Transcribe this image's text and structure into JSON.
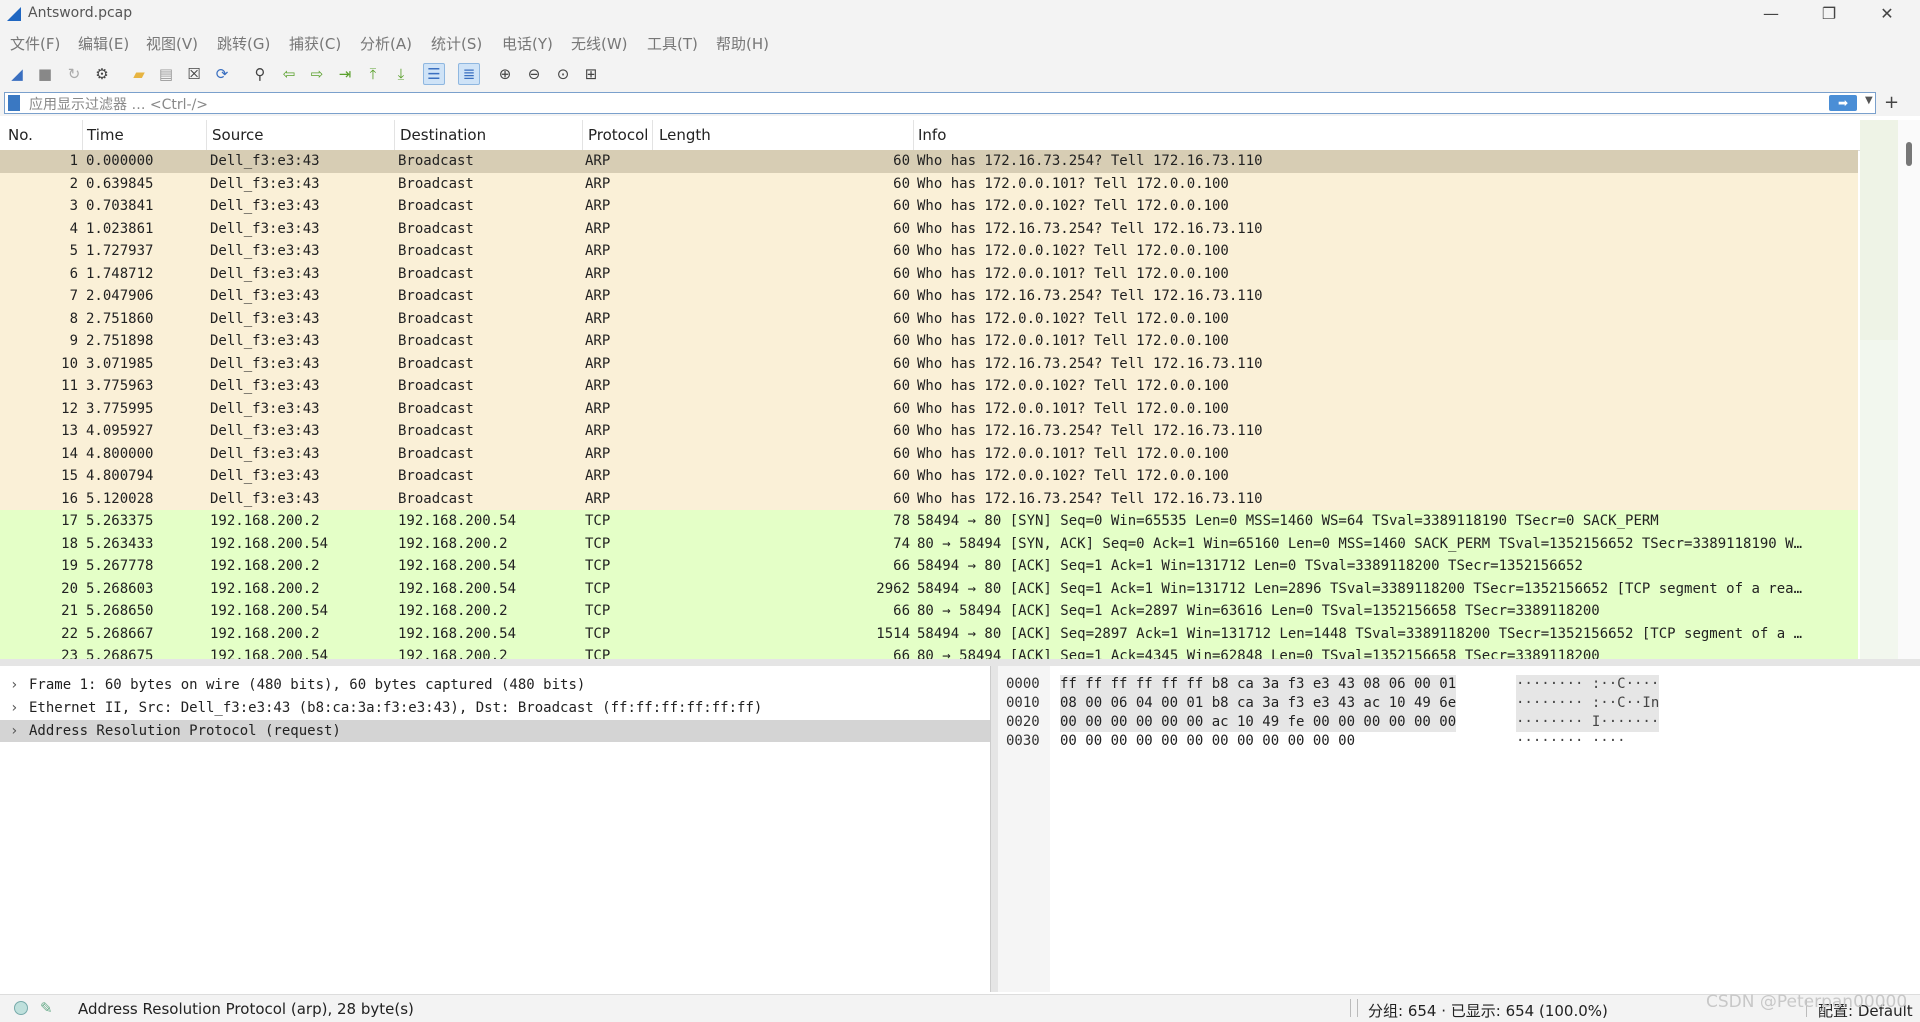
{
  "window": {
    "title": "Antsword.pcap",
    "minimize_glyph": "—",
    "restore_glyph": "❐",
    "close_glyph": "✕"
  },
  "menu": [
    "文件(F)",
    "编辑(E)",
    "视图(V)",
    "跳转(G)",
    "捕获(C)",
    "分析(A)",
    "统计(S)",
    "电话(Y)",
    "无线(W)",
    "工具(T)",
    "帮助(H)"
  ],
  "toolbar": [
    {
      "icon": "shark-fin-start-icon",
      "glyph": "◢",
      "color": "#3a6fc0"
    },
    {
      "icon": "stop-capture-icon",
      "glyph": "■",
      "color": "#888888"
    },
    {
      "icon": "restart-capture-icon",
      "glyph": "↻",
      "color": "#aaaaaa"
    },
    {
      "icon": "capture-options-icon",
      "glyph": "⚙",
      "color": "#444444"
    },
    {
      "icon": "open-file-icon",
      "glyph": "▰",
      "color": "#e7b441"
    },
    {
      "icon": "save-file-icon",
      "glyph": "▤",
      "color": "#999999"
    },
    {
      "icon": "close-file-icon",
      "glyph": "☒",
      "color": "#444444"
    },
    {
      "icon": "reload-file-icon",
      "glyph": "⟳",
      "color": "#3a6fc0"
    },
    {
      "icon": "find-packet-icon",
      "glyph": "⚲",
      "color": "#444444"
    },
    {
      "icon": "go-back-icon",
      "glyph": "⇦",
      "color": "#5aa02c"
    },
    {
      "icon": "go-forward-icon",
      "glyph": "⇨",
      "color": "#5aa02c"
    },
    {
      "icon": "go-to-packet-icon",
      "glyph": "⇥",
      "color": "#5aa02c"
    },
    {
      "icon": "first-packet-icon",
      "glyph": "⤒",
      "color": "#5aa02c"
    },
    {
      "icon": "last-packet-icon",
      "glyph": "⤓",
      "color": "#5aa02c"
    },
    {
      "icon": "autoscroll-icon",
      "glyph": "☰",
      "color": "#3a6fc0"
    },
    {
      "icon": "colorize-icon",
      "glyph": "≣",
      "color": "#3a6fc0"
    },
    {
      "icon": "zoom-in-icon",
      "glyph": "⊕",
      "color": "#444444"
    },
    {
      "icon": "zoom-out-icon",
      "glyph": "⊖",
      "color": "#444444"
    },
    {
      "icon": "normal-size-icon",
      "glyph": "⊙",
      "color": "#444444"
    },
    {
      "icon": "resize-columns-icon",
      "glyph": "⊞",
      "color": "#444444"
    }
  ],
  "filter": {
    "placeholder": "应用显示过滤器 … <Ctrl-/>",
    "apply_glyph": "➡",
    "dropdown_glyph": "▼",
    "add_glyph": "+"
  },
  "columns": {
    "no": "No.",
    "time": "Time",
    "source": "Source",
    "destination": "Destination",
    "protocol": "Protocol",
    "length": "Length",
    "info": "Info"
  },
  "packets": [
    {
      "no": "1",
      "time": "0.000000",
      "src": "Dell_f3:e3:43",
      "dst": "Broadcast",
      "proto": "ARP",
      "len": "60",
      "info": "Who has 172.16.73.254? Tell 172.16.73.110",
      "type": "arp",
      "selected": true
    },
    {
      "no": "2",
      "time": "0.639845",
      "src": "Dell_f3:e3:43",
      "dst": "Broadcast",
      "proto": "ARP",
      "len": "60",
      "info": "Who has 172.0.0.101? Tell 172.0.0.100",
      "type": "arp"
    },
    {
      "no": "3",
      "time": "0.703841",
      "src": "Dell_f3:e3:43",
      "dst": "Broadcast",
      "proto": "ARP",
      "len": "60",
      "info": "Who has 172.0.0.102? Tell 172.0.0.100",
      "type": "arp"
    },
    {
      "no": "4",
      "time": "1.023861",
      "src": "Dell_f3:e3:43",
      "dst": "Broadcast",
      "proto": "ARP",
      "len": "60",
      "info": "Who has 172.16.73.254? Tell 172.16.73.110",
      "type": "arp"
    },
    {
      "no": "5",
      "time": "1.727937",
      "src": "Dell_f3:e3:43",
      "dst": "Broadcast",
      "proto": "ARP",
      "len": "60",
      "info": "Who has 172.0.0.102? Tell 172.0.0.100",
      "type": "arp"
    },
    {
      "no": "6",
      "time": "1.748712",
      "src": "Dell_f3:e3:43",
      "dst": "Broadcast",
      "proto": "ARP",
      "len": "60",
      "info": "Who has 172.0.0.101? Tell 172.0.0.100",
      "type": "arp"
    },
    {
      "no": "7",
      "time": "2.047906",
      "src": "Dell_f3:e3:43",
      "dst": "Broadcast",
      "proto": "ARP",
      "len": "60",
      "info": "Who has 172.16.73.254? Tell 172.16.73.110",
      "type": "arp"
    },
    {
      "no": "8",
      "time": "2.751860",
      "src": "Dell_f3:e3:43",
      "dst": "Broadcast",
      "proto": "ARP",
      "len": "60",
      "info": "Who has 172.0.0.102? Tell 172.0.0.100",
      "type": "arp"
    },
    {
      "no": "9",
      "time": "2.751898",
      "src": "Dell_f3:e3:43",
      "dst": "Broadcast",
      "proto": "ARP",
      "len": "60",
      "info": "Who has 172.0.0.101? Tell 172.0.0.100",
      "type": "arp"
    },
    {
      "no": "10",
      "time": "3.071985",
      "src": "Dell_f3:e3:43",
      "dst": "Broadcast",
      "proto": "ARP",
      "len": "60",
      "info": "Who has 172.16.73.254? Tell 172.16.73.110",
      "type": "arp"
    },
    {
      "no": "11",
      "time": "3.775963",
      "src": "Dell_f3:e3:43",
      "dst": "Broadcast",
      "proto": "ARP",
      "len": "60",
      "info": "Who has 172.0.0.102? Tell 172.0.0.100",
      "type": "arp"
    },
    {
      "no": "12",
      "time": "3.775995",
      "src": "Dell_f3:e3:43",
      "dst": "Broadcast",
      "proto": "ARP",
      "len": "60",
      "info": "Who has 172.0.0.101? Tell 172.0.0.100",
      "type": "arp"
    },
    {
      "no": "13",
      "time": "4.095927",
      "src": "Dell_f3:e3:43",
      "dst": "Broadcast",
      "proto": "ARP",
      "len": "60",
      "info": "Who has 172.16.73.254? Tell 172.16.73.110",
      "type": "arp"
    },
    {
      "no": "14",
      "time": "4.800000",
      "src": "Dell_f3:e3:43",
      "dst": "Broadcast",
      "proto": "ARP",
      "len": "60",
      "info": "Who has 172.0.0.101? Tell 172.0.0.100",
      "type": "arp"
    },
    {
      "no": "15",
      "time": "4.800794",
      "src": "Dell_f3:e3:43",
      "dst": "Broadcast",
      "proto": "ARP",
      "len": "60",
      "info": "Who has 172.0.0.102? Tell 172.0.0.100",
      "type": "arp"
    },
    {
      "no": "16",
      "time": "5.120028",
      "src": "Dell_f3:e3:43",
      "dst": "Broadcast",
      "proto": "ARP",
      "len": "60",
      "info": "Who has 172.16.73.254? Tell 172.16.73.110",
      "type": "arp"
    },
    {
      "no": "17",
      "time": "5.263375",
      "src": "192.168.200.2",
      "dst": "192.168.200.54",
      "proto": "TCP",
      "len": "78",
      "info": "58494 → 80 [SYN] Seq=0 Win=65535 Len=0 MSS=1460 WS=64 TSval=3389118190 TSecr=0 SACK_PERM",
      "type": "tcp"
    },
    {
      "no": "18",
      "time": "5.263433",
      "src": "192.168.200.54",
      "dst": "192.168.200.2",
      "proto": "TCP",
      "len": "74",
      "info": "80 → 58494 [SYN, ACK] Seq=0 Ack=1 Win=65160 Len=0 MSS=1460 SACK_PERM TSval=1352156652 TSecr=3389118190 W…",
      "type": "tcp"
    },
    {
      "no": "19",
      "time": "5.267778",
      "src": "192.168.200.2",
      "dst": "192.168.200.54",
      "proto": "TCP",
      "len": "66",
      "info": "58494 → 80 [ACK] Seq=1 Ack=1 Win=131712 Len=0 TSval=3389118200 TSecr=1352156652",
      "type": "tcp"
    },
    {
      "no": "20",
      "time": "5.268603",
      "src": "192.168.200.2",
      "dst": "192.168.200.54",
      "proto": "TCP",
      "len": "2962",
      "info": "58494 → 80 [ACK] Seq=1 Ack=1 Win=131712 Len=2896 TSval=3389118200 TSecr=1352156652 [TCP segment of a rea…",
      "type": "tcp"
    },
    {
      "no": "21",
      "time": "5.268650",
      "src": "192.168.200.54",
      "dst": "192.168.200.2",
      "proto": "TCP",
      "len": "66",
      "info": "80 → 58494 [ACK] Seq=1 Ack=2897 Win=63616 Len=0 TSval=1352156658 TSecr=3389118200",
      "type": "tcp"
    },
    {
      "no": "22",
      "time": "5.268667",
      "src": "192.168.200.2",
      "dst": "192.168.200.54",
      "proto": "TCP",
      "len": "1514",
      "info": "58494 → 80 [ACK] Seq=2897 Ack=1 Win=131712 Len=1448 TSval=3389118200 TSecr=1352156652 [TCP segment of a …",
      "type": "tcp"
    },
    {
      "no": "23",
      "time": "5.268675",
      "src": "192.168.200.54",
      "dst": "192.168.200.2",
      "proto": "TCP",
      "len": "66",
      "info": "80 → 58494 [ACK] Seq=1 Ack=4345 Win=62848 Len=0 TSval=1352156658 TSecr=3389118200",
      "type": "tcp"
    }
  ],
  "details": [
    {
      "arrow": "›",
      "text": "Frame 1: 60 bytes on wire (480 bits), 60 bytes captured (480 bits)",
      "selected": false
    },
    {
      "arrow": "›",
      "text": "Ethernet II, Src: Dell_f3:e3:43 (b8:ca:3a:f3:e3:43), Dst: Broadcast (ff:ff:ff:ff:ff:ff)",
      "selected": false
    },
    {
      "arrow": "›",
      "text": "Address Resolution Protocol (request)",
      "selected": true
    }
  ],
  "bytes": [
    {
      "offset": "0000",
      "hex": "ff ff ff ff ff ff b8 ca  3a f3 e3 43 08 06 00 01",
      "ascii": "········ :··C····",
      "highlight": true
    },
    {
      "offset": "0010",
      "hex": "08 00 06 04 00 01 b8 ca  3a f3 e3 43 ac 10 49 6e",
      "ascii": "········ :··C··In",
      "highlight": true
    },
    {
      "offset": "0020",
      "hex": "00 00 00 00 00 00 ac 10  49 fe 00 00 00 00 00 00",
      "ascii": "········ I·······",
      "highlight": true
    },
    {
      "offset": "0030",
      "hex": "00 00 00 00 00 00 00 00  00 00 00 00",
      "ascii": "········ ····",
      "highlight": false
    }
  ],
  "status": {
    "text": "Address Resolution Protocol (arp), 28 byte(s)",
    "counts": "分组: 654 · 已显示: 654 (100.0%)",
    "profile": "配置: Default"
  },
  "watermark": "CSDN @Peterpan00000",
  "colors": {
    "arp_row": "#faf0d7",
    "tcp_row": "#e4ffc7",
    "selected_row": "#d7cdb4"
  }
}
